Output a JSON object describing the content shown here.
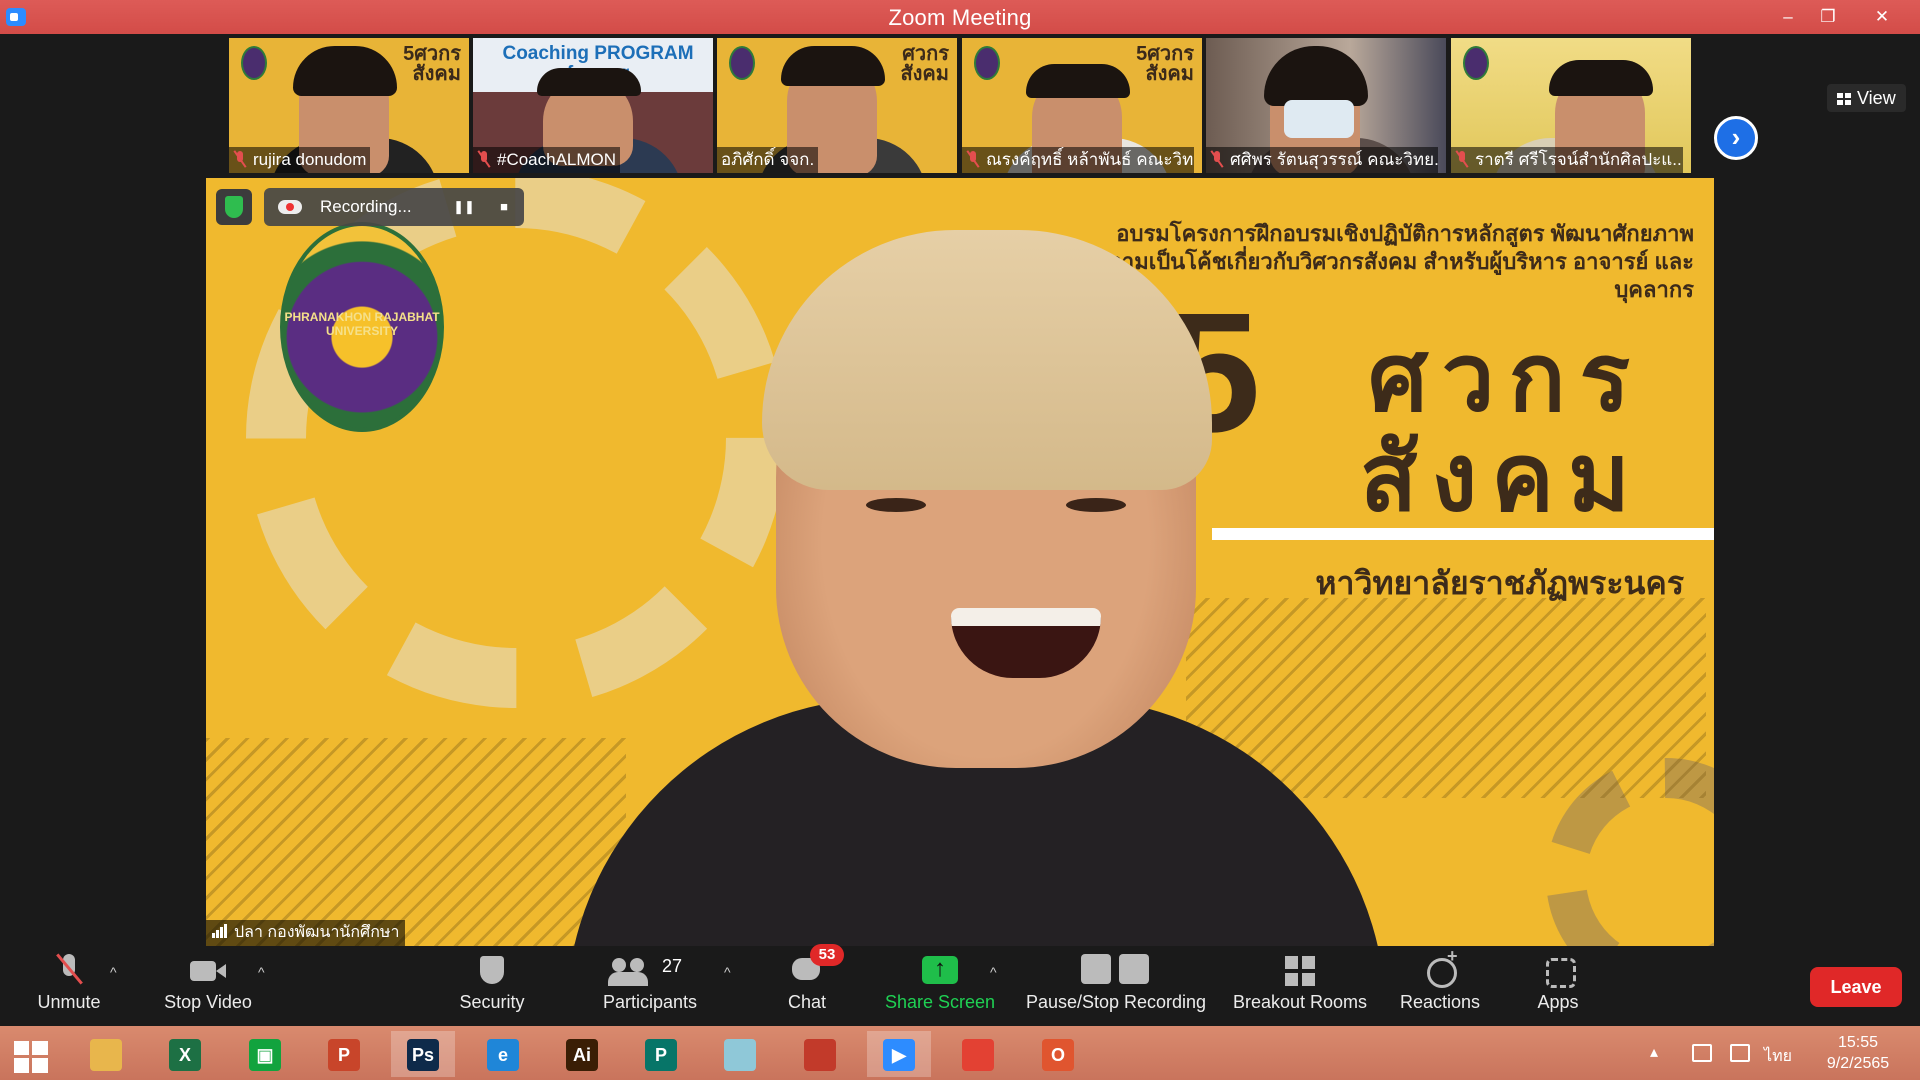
{
  "window": {
    "title": "Zoom Meeting",
    "minimize": "–",
    "restore": "❐",
    "close": "✕"
  },
  "gallery": {
    "participants": [
      {
        "name": "rujira donudom",
        "poster": "5ศวกร สังคม"
      },
      {
        "name": "#CoachALMON",
        "poster": "Coaching PROGRAM for…er"
      },
      {
        "name": "อภิศักดิ์ จจก.",
        "poster": "ศวกร สังคม"
      },
      {
        "name": "ณรงค์ฤทธิ์ หล้าพันธ์ คณะวิทย์",
        "poster": "5ศวกร สังคม"
      },
      {
        "name": "ศศิพร รัตนสุวรรณ์ คณะวิทย...",
        "poster": ""
      },
      {
        "name": "ราตรี   ศรีโรจน์สำนักศิลปะแ...",
        "poster": ""
      }
    ],
    "view_label": "View",
    "next_icon": "›"
  },
  "main": {
    "speaker_name": "ปลา กองพัฒนานักศึกษา",
    "recording_label": "Recording...",
    "pause_symbol": "❚❚",
    "stop_symbol": "■",
    "poster": {
      "heading": "อบรมโครงการฝึกอบรมเชิงปฏิบัติการหลักสูตร พัฒนาศักยภาพความเป็นโค้ชเกี่ยวกับวิศวกรสังคม สำหรับผู้บริหาร อาจารย์ และบุคลากร",
      "big_line_1": "ศวกร",
      "big_line_2": "สังคม",
      "big_number": "5",
      "university": "หาวิทยาลัยราชภัฏพระนคร",
      "seal_text": "PHRANAKHON RAJABHAT UNIVERSITY"
    }
  },
  "toolbar": {
    "unmute": "Unmute",
    "stop_video": "Stop Video",
    "security": "Security",
    "participants": "Participants",
    "participants_count": "27",
    "chat": "Chat",
    "chat_badge": "53",
    "share_screen": "Share Screen",
    "pause_stop_recording": "Pause/Stop Recording",
    "breakout_rooms": "Breakout Rooms",
    "reactions": "Reactions",
    "apps": "Apps",
    "leave": "Leave",
    "caret": "^"
  },
  "taskbar": {
    "apps": [
      {
        "name": "file-explorer",
        "glyph": "",
        "color": "#e8b64c"
      },
      {
        "name": "excel",
        "glyph": "X",
        "color": "#1d7044"
      },
      {
        "name": "store",
        "glyph": "▣",
        "color": "#12a33e"
      },
      {
        "name": "powerpoint",
        "glyph": "P",
        "color": "#c8452a"
      },
      {
        "name": "photoshop",
        "glyph": "Ps",
        "color": "#0e2a4a"
      },
      {
        "name": "internet-explorer",
        "glyph": "e",
        "color": "#1f86d8"
      },
      {
        "name": "illustrator",
        "glyph": "Ai",
        "color": "#3a1e05"
      },
      {
        "name": "publisher",
        "glyph": "P",
        "color": "#077568"
      },
      {
        "name": "notepad",
        "glyph": "",
        "color": "#8fc8d8"
      },
      {
        "name": "photoscape",
        "glyph": "",
        "color": "#c23a2a"
      },
      {
        "name": "zoom",
        "glyph": "▶",
        "color": "#2d8cff"
      },
      {
        "name": "chrome",
        "glyph": "",
        "color": "#e34133"
      },
      {
        "name": "office",
        "glyph": "O",
        "color": "#e0552f"
      }
    ],
    "language": "ไทย",
    "time": "15:55",
    "date": "9/2/2565",
    "overflow": "▴"
  },
  "colors": {
    "title_bar": "#d34c48",
    "leave": "#e02828",
    "share_screen": "#1fbe4a",
    "poster_yellow": "#f0b92e"
  }
}
